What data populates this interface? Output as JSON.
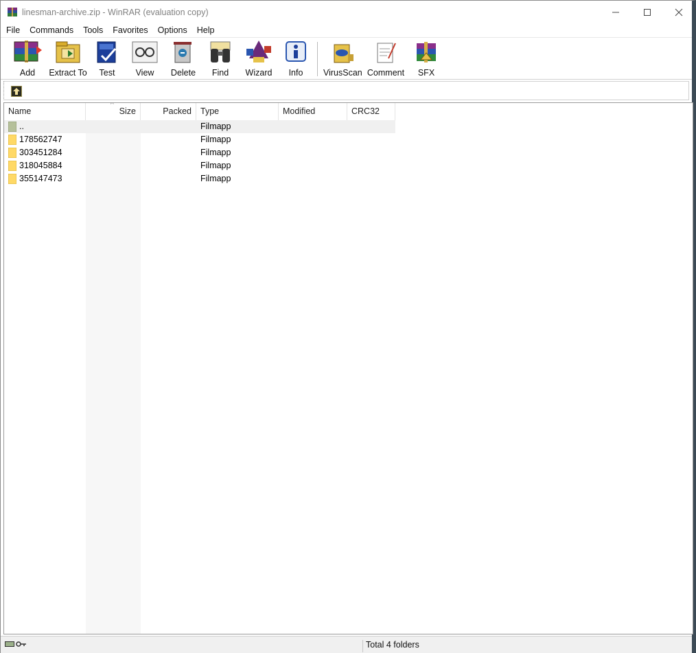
{
  "window": {
    "title": "linesman-archive.zip - WinRAR (evaluation copy)",
    "buttons": {
      "minimize_icon": "minimize-icon",
      "maximize_icon": "maximize-icon",
      "close_icon": "close-icon"
    }
  },
  "menu": {
    "items": [
      {
        "label": "File"
      },
      {
        "label": "Commands"
      },
      {
        "label": "Tools"
      },
      {
        "label": "Favorites"
      },
      {
        "label": "Options"
      },
      {
        "label": "Help"
      }
    ]
  },
  "toolbar": {
    "buttons": [
      {
        "label": "Add",
        "icon": "add-archive-icon"
      },
      {
        "label": "Extract To",
        "icon": "extract-to-icon"
      },
      {
        "label": "Test",
        "icon": "test-icon"
      },
      {
        "label": "View",
        "icon": "view-glasses-icon"
      },
      {
        "label": "Delete",
        "icon": "delete-icon"
      },
      {
        "label": "Find",
        "icon": "find-binoculars-icon"
      },
      {
        "label": "Wizard",
        "icon": "wizard-icon"
      },
      {
        "label": "Info",
        "icon": "info-icon"
      },
      {
        "label": "VirusScan",
        "icon": "virusscan-icon"
      },
      {
        "label": "Comment",
        "icon": "comment-icon"
      },
      {
        "label": "SFX",
        "icon": "sfx-icon"
      }
    ]
  },
  "list": {
    "columns": [
      "Name",
      "Size",
      "Packed",
      "Type",
      "Modified",
      "CRC32"
    ],
    "rows": [
      {
        "name": "..",
        "type": "Filmapp"
      },
      {
        "name": "178562747",
        "type": "Filmapp"
      },
      {
        "name": "303451284",
        "type": "Filmapp"
      },
      {
        "name": "318045884",
        "type": "Filmapp"
      },
      {
        "name": "355147473",
        "type": "Filmapp"
      }
    ]
  },
  "status": {
    "text": "Total 4 folders"
  },
  "colors": {
    "folder": "#ffd966",
    "parent_folder": "#b5c09a",
    "accent_border": "#3c4a55"
  }
}
